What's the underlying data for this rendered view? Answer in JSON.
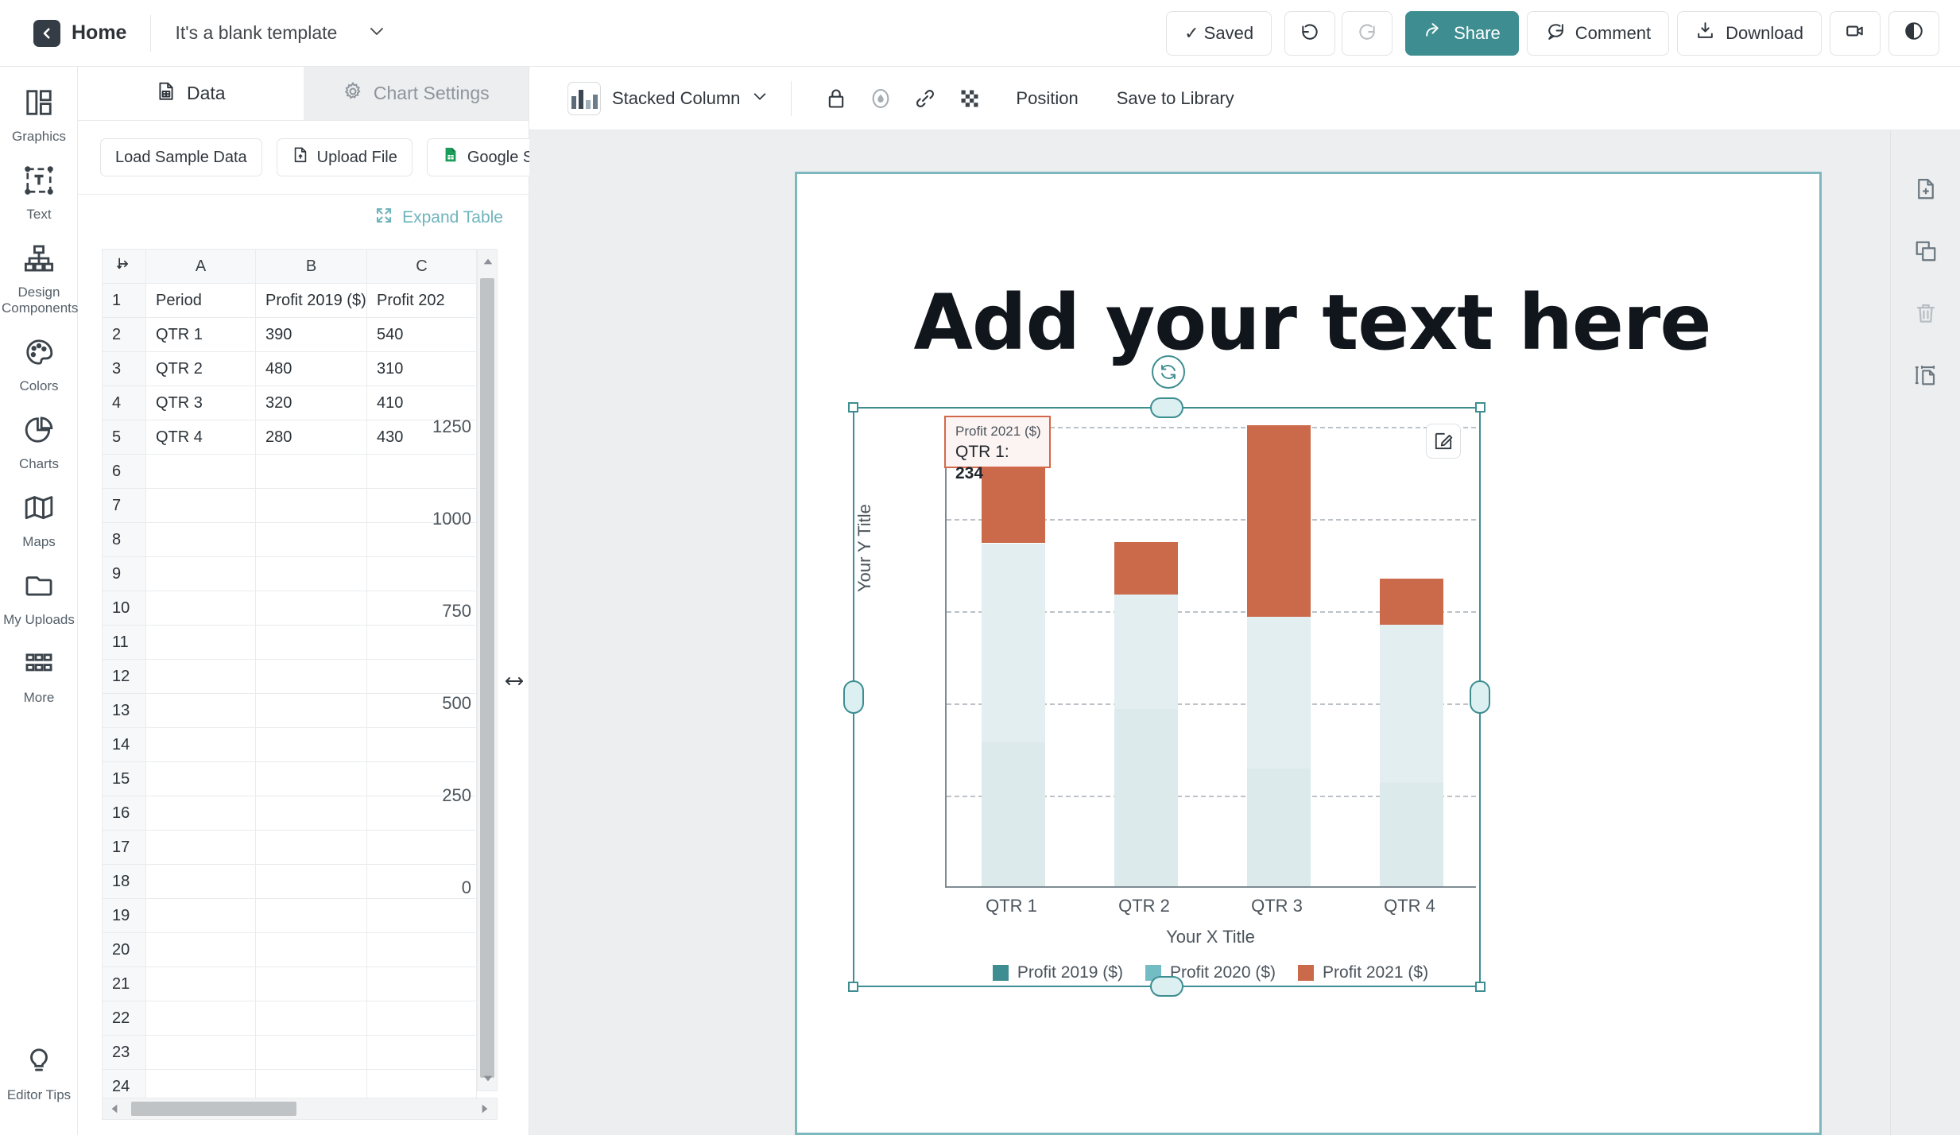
{
  "topbar": {
    "home_label": "Home",
    "doc_title": "It's a blank template",
    "saved_label": "✓ Saved",
    "share_label": "Share",
    "comment_label": "Comment",
    "download_label": "Download",
    "icons": {
      "back": "chevron-left-icon",
      "caret": "chevron-down-icon",
      "undo": "undo-icon",
      "redo": "redo-icon",
      "share": "share-icon",
      "comment": "comment-icon",
      "download": "download-icon",
      "record": "video-camera-icon",
      "preview": "eye-icon"
    },
    "accent": "#3e8e91"
  },
  "rail": {
    "items": [
      {
        "label": "Graphics",
        "icon": "graphics-icon"
      },
      {
        "label": "Text",
        "icon": "text-icon"
      },
      {
        "label": "Design Components",
        "icon": "design-components-icon"
      },
      {
        "label": "Colors",
        "icon": "palette-icon"
      },
      {
        "label": "Charts",
        "icon": "pie-chart-icon"
      },
      {
        "label": "Maps",
        "icon": "map-icon"
      },
      {
        "label": "My Uploads",
        "icon": "folder-icon"
      },
      {
        "label": "More",
        "icon": "grid-dots-icon"
      }
    ],
    "bottom": {
      "label": "Editor Tips",
      "icon": "lightbulb-icon"
    }
  },
  "panel": {
    "tabs": [
      {
        "label": "Data",
        "icon": "data-file-icon",
        "active": true
      },
      {
        "label": "Chart Settings",
        "icon": "gear-icon",
        "active": false
      }
    ],
    "actions": [
      {
        "label": "Load Sample Data",
        "icon": "none"
      },
      {
        "label": "Upload File",
        "icon": "upload-file-icon"
      },
      {
        "label": "Google Sheets",
        "icon": "google-sheets-icon"
      }
    ],
    "expand_label": "Expand Table",
    "expand_icon": "expand-arrows-icon"
  },
  "sheet": {
    "corner_icon": "select-all-icon",
    "column_headers": [
      "A",
      "B",
      "C"
    ],
    "rows": [
      {
        "n": "1",
        "cells": [
          "Period",
          "Profit 2019 ($)",
          "Profit 202"
        ]
      },
      {
        "n": "2",
        "cells": [
          "QTR 1",
          "390",
          "540"
        ]
      },
      {
        "n": "3",
        "cells": [
          "QTR 2",
          "480",
          "310"
        ]
      },
      {
        "n": "4",
        "cells": [
          "QTR 3",
          "320",
          "410"
        ]
      },
      {
        "n": "5",
        "cells": [
          "QTR 4",
          "280",
          "430"
        ]
      },
      {
        "n": "6",
        "cells": [
          "",
          "",
          ""
        ]
      },
      {
        "n": "7",
        "cells": [
          "",
          "",
          ""
        ]
      },
      {
        "n": "8",
        "cells": [
          "",
          "",
          ""
        ]
      },
      {
        "n": "9",
        "cells": [
          "",
          "",
          ""
        ]
      },
      {
        "n": "10",
        "cells": [
          "",
          "",
          ""
        ]
      },
      {
        "n": "11",
        "cells": [
          "",
          "",
          ""
        ]
      },
      {
        "n": "12",
        "cells": [
          "",
          "",
          ""
        ]
      },
      {
        "n": "13",
        "cells": [
          "",
          "",
          ""
        ]
      },
      {
        "n": "14",
        "cells": [
          "",
          "",
          ""
        ]
      },
      {
        "n": "15",
        "cells": [
          "",
          "",
          ""
        ]
      },
      {
        "n": "16",
        "cells": [
          "",
          "",
          ""
        ]
      },
      {
        "n": "17",
        "cells": [
          "",
          "",
          ""
        ]
      },
      {
        "n": "18",
        "cells": [
          "",
          "",
          ""
        ]
      },
      {
        "n": "19",
        "cells": [
          "",
          "",
          ""
        ]
      },
      {
        "n": "20",
        "cells": [
          "",
          "",
          ""
        ]
      },
      {
        "n": "21",
        "cells": [
          "",
          "",
          ""
        ]
      },
      {
        "n": "22",
        "cells": [
          "",
          "",
          ""
        ]
      },
      {
        "n": "23",
        "cells": [
          "",
          "",
          ""
        ]
      },
      {
        "n": "24",
        "cells": [
          "",
          "",
          ""
        ]
      }
    ]
  },
  "chart_toolbar": {
    "type_label": "Stacked Column",
    "type_icon": "bar-chart-icon",
    "caret_icon": "chevron-down-icon",
    "icons": [
      "lock-icon",
      "opacity-icon",
      "link-icon",
      "transparency-icon"
    ],
    "position_label": "Position",
    "save_library_label": "Save to Library"
  },
  "canvas": {
    "heading": "Add your text here",
    "edit_icon": "pencil-square-icon",
    "rotate_icon": "rotate-icon"
  },
  "tooltip": {
    "series": "Profit 2021 ($)",
    "category": "QTR 1",
    "separator": ": ",
    "value": "234",
    "border_color": "#d2694a",
    "bg_color": "#fcf4f2"
  },
  "right_rail": {
    "icons": [
      "add-page-icon",
      "duplicate-icon",
      "trash-icon",
      "resize-page-icon"
    ]
  },
  "chart_data": {
    "type": "bar",
    "stacked": true,
    "title": "",
    "xlabel": "Your X Title",
    "ylabel": "Your Y Title",
    "categories": [
      "QTR 1",
      "QTR 2",
      "QTR 3",
      "QTR 4"
    ],
    "ylim": [
      0,
      1250
    ],
    "yticks": [
      0,
      250,
      500,
      750,
      1000,
      1250
    ],
    "grid": true,
    "legend_position": "bottom",
    "series": [
      {
        "name": "Profit 2019 ($)",
        "color": "#3e8e91",
        "values": [
          390,
          480,
          320,
          280
        ]
      },
      {
        "name": "Profit 2020 ($)",
        "color": "#74bcc4",
        "values": [
          540,
          310,
          410,
          430
        ]
      },
      {
        "name": "Profit 2021 ($)",
        "color": "#cb6a4b",
        "values": [
          234,
          144,
          520,
          124
        ]
      }
    ],
    "stack_totals": [
      1164,
      934,
      1250,
      834
    ],
    "bar_fill_rendered": "#dfeced",
    "top_segment_color": "#cb6a4b"
  }
}
